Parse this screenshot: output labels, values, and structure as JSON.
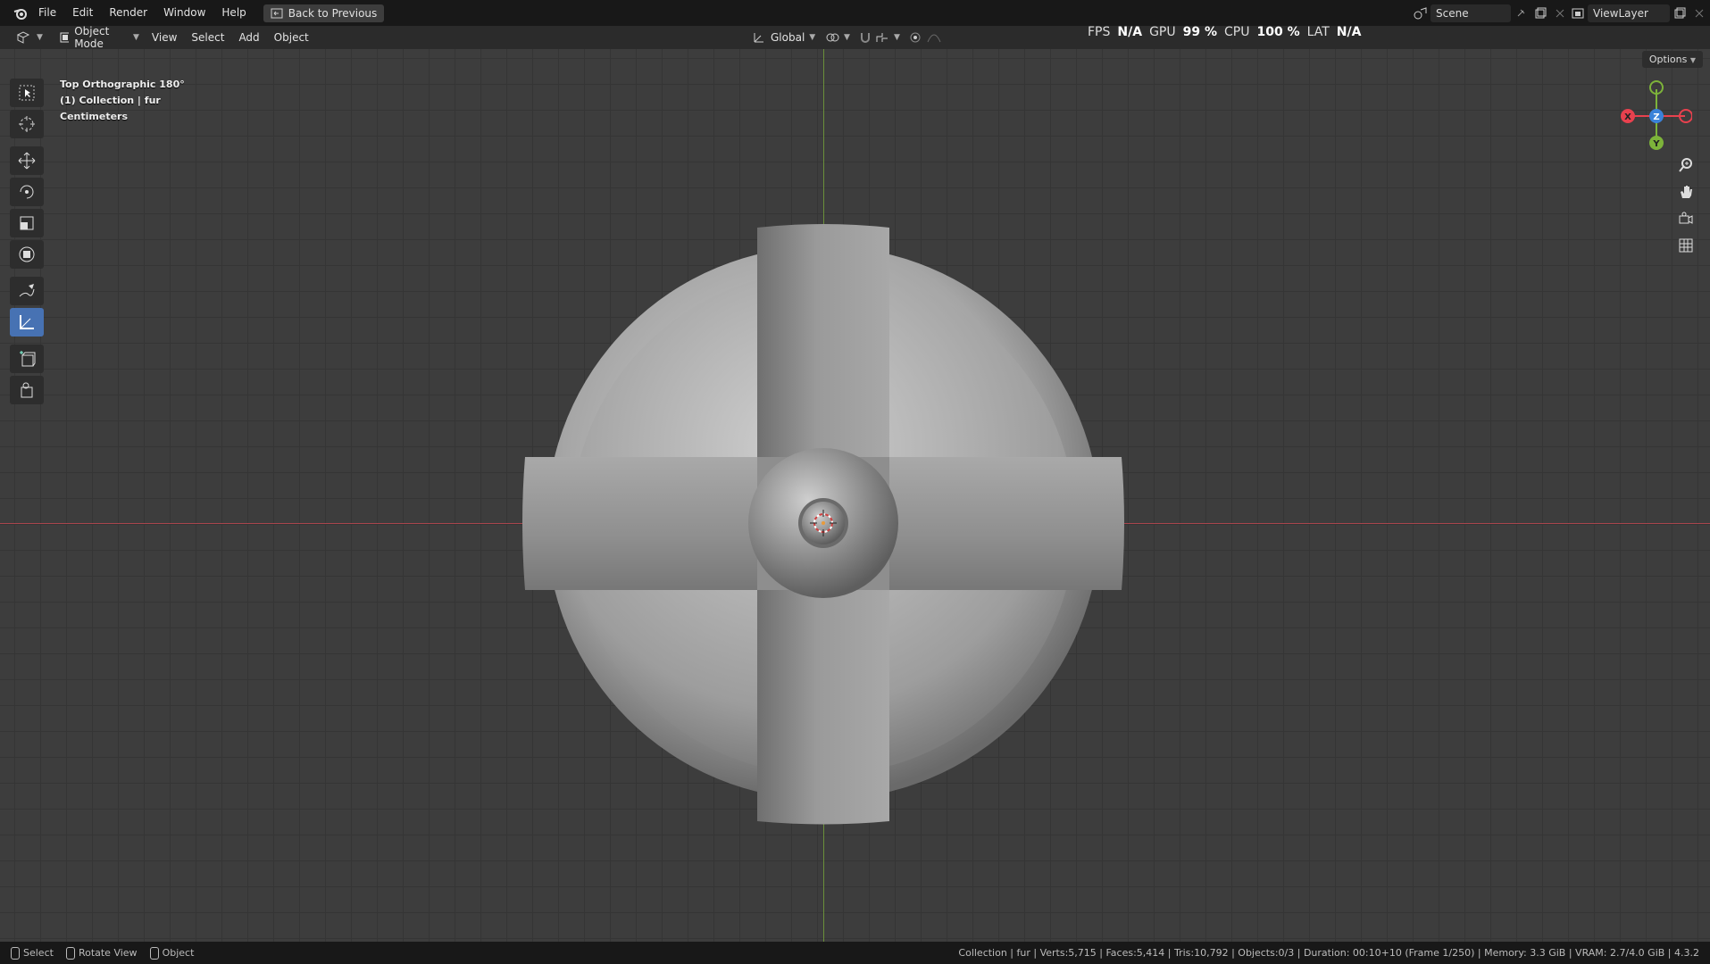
{
  "menu": {
    "items": [
      "File",
      "Edit",
      "Render",
      "Window",
      "Help"
    ],
    "back_button": "Back to Previous"
  },
  "scene": {
    "label": "Scene",
    "view_layer": "ViewLayer"
  },
  "header": {
    "mode": "Object Mode",
    "menus": [
      "View",
      "Select",
      "Add",
      "Object"
    ],
    "orientation": "Global"
  },
  "stats": {
    "fps_label": "FPS",
    "fps_value": "N/A",
    "gpu_label": "GPU",
    "gpu_value": "99 %",
    "cpu_label": "CPU",
    "cpu_value": "100 %",
    "lat_label": "LAT",
    "lat_value": "N/A"
  },
  "viewport": {
    "view_name": "Top Orthographic 180°",
    "collection": "(1) Collection | fur",
    "units": "Centimeters",
    "options_label": "Options"
  },
  "gizmo": {
    "x": "X",
    "y": "Y",
    "z": "Z",
    "x_color": "#e8414e",
    "y_color": "#7db33a",
    "z_color": "#3b82d9"
  },
  "status": {
    "select": "Select",
    "rotate": "Rotate View",
    "object": "Object",
    "info": "Collection | fur | Verts:5,715 | Faces:5,414 | Tris:10,792 | Objects:0/3 | Duration: 00:10+10 (Frame 1/250) | Memory: 3.3 GiB | VRAM: 2.7/4.0 GiB | 4.3.2"
  },
  "colors": {
    "accent": "#4772b3",
    "axis_x": "#a8454d",
    "axis_y": "#6a8f3a"
  }
}
